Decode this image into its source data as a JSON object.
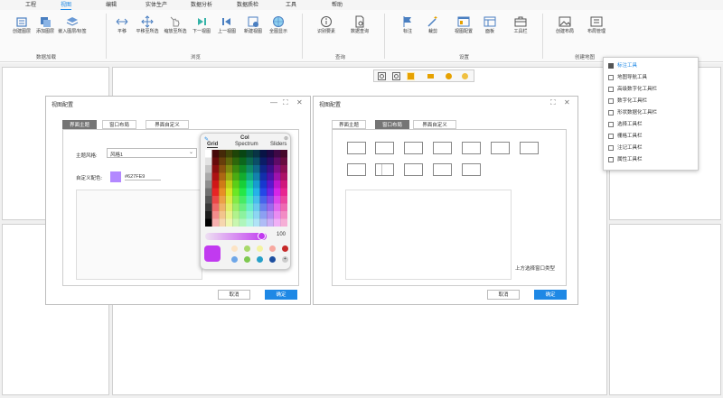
{
  "menubar": {
    "items": [
      "工程",
      "视图",
      "编辑",
      "实体生产",
      "数据分析",
      "数据质检",
      "工具",
      "帮助"
    ],
    "active": "视图"
  },
  "ribbon": {
    "buttons": [
      "创建图层",
      "添加图层",
      "嵌入图层/标签",
      "平移",
      "平移至所选",
      "缩放至所选",
      "下一视图",
      "上一视图",
      "新建视图",
      "全图显示",
      "识别要素",
      "数据查询",
      "标注",
      "裁剪",
      "视图配置",
      "面板",
      "工具栏",
      "创建布局",
      "布局管理"
    ],
    "groups": [
      "数据加载",
      "浏览",
      "查询",
      "设置",
      "创建地图"
    ]
  },
  "dialog_left": {
    "title": "视图配置",
    "tabs": [
      "界面主题",
      "窗口布局",
      "界面自定义"
    ],
    "theme_label": "主题风格:",
    "theme_value": "风格1",
    "color_label": "自定义配色:",
    "color_value": "#627FE9",
    "cancel": "取消",
    "ok": "确定"
  },
  "dialog_right": {
    "title": "视图配置",
    "tabs": [
      "界面主题",
      "窗口布局",
      "界面自定义"
    ],
    "hint": "上方选择窗口类型",
    "cancel": "取消",
    "ok": "确定"
  },
  "color_picker": {
    "tabs": [
      "Grid",
      "Spectrum",
      "Sliders"
    ],
    "heading": "Col",
    "opacity_value": "100"
  },
  "toolbar_menu": {
    "items": [
      "标注工具",
      "地图导航工具",
      "高级数字化工具栏",
      "数字化工具栏",
      "形状数据化工具栏",
      "选择工具栏",
      "栅格工具栏",
      "注记工具栏",
      "属性工具栏"
    ],
    "checked": "标注工具"
  },
  "colors": {
    "accent": "#1e88e5",
    "swatch": "#b388ff",
    "selected_color": "#c13af0"
  }
}
